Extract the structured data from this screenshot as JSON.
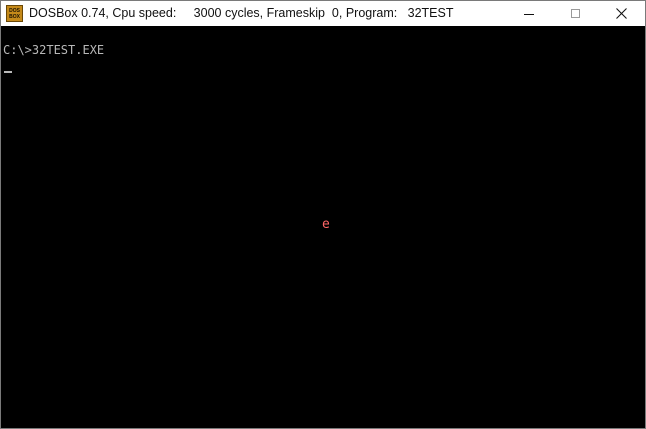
{
  "window": {
    "title": "DOSBox 0.74, Cpu speed:     3000 cycles, Frameskip  0, Program:   32TEST",
    "app_icon": {
      "name": "dosbox-icon",
      "line1": "DOS",
      "line2": "BOX"
    },
    "controls": {
      "minimize_icon": "minimize-icon",
      "maximize_icon": "maximize-icon",
      "close_icon": "close-icon"
    }
  },
  "console": {
    "prompt": "C:\\>32TEST.EXE",
    "cursor": "_",
    "output_char": "e",
    "output_color": "#ff6666",
    "background_color": "#000000",
    "text_color": "#b8b8b8"
  }
}
